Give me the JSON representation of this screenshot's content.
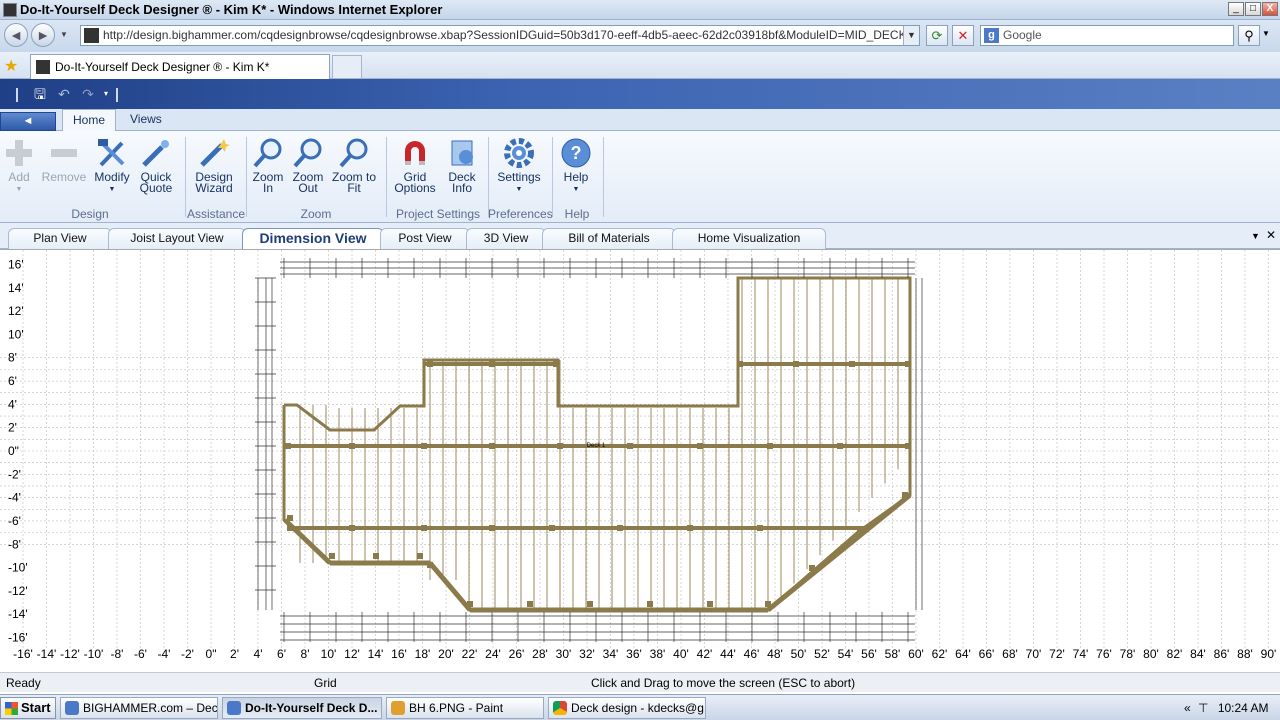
{
  "window": {
    "title": "Do-It-Yourself Deck Designer ® - Kim K* - Windows Internet Explorer",
    "min": "_",
    "max": "□",
    "close": "X"
  },
  "browser": {
    "back": "◄",
    "forward": "►",
    "url": "http://design.bighammer.com/cqdesignbrowse/cqdesignbrowse.xbap?SessionIDGuid=50b3d170-eeff-4db5-aeec-62d2c03918bf&ModuleID=MID_DECKS&alt_interface",
    "search_placeholder": "Google",
    "tab_title": "Do-It-Yourself Deck Designer ® - Kim K*"
  },
  "ribbon": {
    "tabs": [
      "Home",
      "Views"
    ],
    "buttons": {
      "add": "Add",
      "remove": "Remove",
      "modify": "Modify",
      "quick": "Quick",
      "quote": "Quote",
      "design": "Design",
      "wizard": "Wizard",
      "zoom_in_1": "Zoom",
      "zoom_in_2": "In",
      "zoom_out_1": "Zoom",
      "zoom_out_2": "Out",
      "zoom_fit_1": "Zoom to",
      "zoom_fit_2": "Fit",
      "grid_1": "Grid",
      "grid_2": "Options",
      "deck_1": "Deck",
      "deck_2": "Info",
      "settings": "Settings",
      "help": "Help"
    },
    "groups": {
      "design": "Design",
      "assistance": "Assistance",
      "zoom": "Zoom",
      "project": "Project Settings",
      "preferences": "Preferences",
      "help": "Help"
    }
  },
  "view_tabs": [
    "Plan View",
    "Joist Layout View",
    "Dimension View",
    "Post View",
    "3D View",
    "Bill of Materials",
    "Home Visualization"
  ],
  "canvas": {
    "y_axis": [
      "16'",
      "14'",
      "12'",
      "10'",
      "8'",
      "6'",
      "4'",
      "2'",
      "0\"",
      "-2'",
      "-4'",
      "-6'",
      "-8'",
      "-10'",
      "-12'",
      "-14'",
      "-16'"
    ],
    "x_axis": [
      "-16'",
      "-14'",
      "-12'",
      "-10'",
      "-8'",
      "-6'",
      "-4'",
      "-2'",
      "0\"",
      "2'",
      "4'",
      "6'",
      "8'",
      "10'",
      "12'",
      "14'",
      "16'",
      "18'",
      "20'",
      "22'",
      "24'",
      "26'",
      "28'",
      "30'",
      "32'",
      "34'",
      "36'",
      "38'",
      "40'",
      "42'",
      "44'",
      "46'",
      "48'",
      "50'",
      "52'",
      "54'",
      "56'",
      "58'",
      "60'",
      "62'",
      "64'",
      "66'",
      "68'",
      "70'",
      "72'",
      "74'",
      "76'",
      "78'",
      "80'",
      "82'",
      "84'",
      "86'",
      "88'",
      "90'"
    ],
    "deck_label": "Deck 1",
    "colors": {
      "frame": "#8b7a4a",
      "joist": "#9a8a5c",
      "grid": "#bdbdbd"
    }
  },
  "status": {
    "left": "Ready",
    "grid": "Grid",
    "hint": "Click and Drag to move the screen  (ESC to abort)"
  },
  "taskbar": {
    "start": "Start",
    "items": [
      "BIGHAMMER.com – Deck...",
      "Do-It-Yourself Deck D...",
      "BH 6.PNG - Paint",
      "Deck design - kdecks@g..."
    ],
    "time": "10:24 AM"
  }
}
